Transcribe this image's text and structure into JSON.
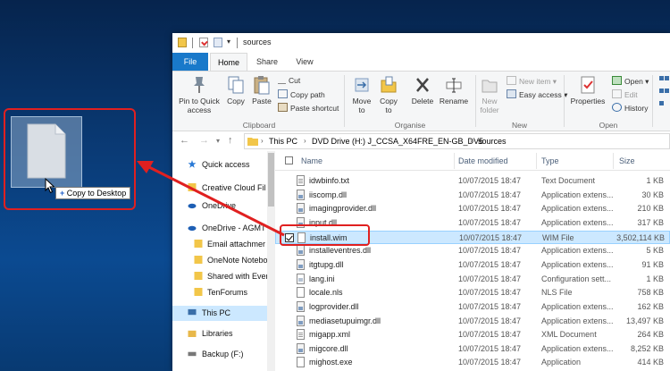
{
  "desktop": {
    "drag_tooltip_plus": "+",
    "drag_tooltip_text": "Copy to Desktop"
  },
  "window": {
    "title": "sources",
    "tabs": [
      "File",
      "Home",
      "Share",
      "View"
    ],
    "ribbon": {
      "clipboard": {
        "pin_label": "Pin to Quick access",
        "copy_label": "Copy",
        "paste_label": "Paste",
        "cut_label": "Cut",
        "copy_path_label": "Copy path",
        "paste_shortcut_label": "Paste shortcut",
        "group_label": "Clipboard"
      },
      "organise": {
        "move_to_label": "Move to",
        "copy_to_label": "Copy to",
        "delete_label": "Delete",
        "rename_label": "Rename",
        "group_label": "Organise"
      },
      "new": {
        "new_folder_label": "New folder",
        "new_item_label": "New item",
        "easy_access_label": "Easy access",
        "group_label": "New"
      },
      "open": {
        "properties_label": "Properties",
        "open_label": "Open",
        "edit_label": "Edit",
        "history_label": "History",
        "group_label": "Open"
      }
    },
    "address": {
      "crumbs": [
        "This PC",
        "DVD Drive (H:) J_CCSA_X64FRE_EN-GB_DV5",
        "sources"
      ]
    },
    "nav_items": [
      {
        "label": "Quick access",
        "icon": "star-icon"
      },
      {
        "label": "Creative Cloud Fil",
        "icon": "cloud-icon"
      },
      {
        "label": "OneDrive",
        "icon": "onedrive-icon"
      },
      {
        "label": "OneDrive - AGMT",
        "icon": "onedrive-icon"
      },
      {
        "label": "Email attachmer",
        "icon": "folder-icon"
      },
      {
        "label": "OneNote Notebo",
        "icon": "folder-icon"
      },
      {
        "label": "Shared with Ever",
        "icon": "folder-icon"
      },
      {
        "label": "TenForums",
        "icon": "folder-icon"
      },
      {
        "label": "This PC",
        "icon": "pc-icon"
      },
      {
        "label": "Libraries",
        "icon": "library-icon"
      },
      {
        "label": "Backup (F:)",
        "icon": "drive-icon"
      }
    ],
    "columns": {
      "name": "Name",
      "date": "Date modified",
      "type": "Type",
      "size": "Size"
    },
    "files": [
      {
        "name": "idwbinfo.txt",
        "date": "10/07/2015 18:47",
        "type": "Text Document",
        "size": "1 KB",
        "icon": "txt"
      },
      {
        "name": "iiscomp.dll",
        "date": "10/07/2015 18:47",
        "type": "Application extens...",
        "size": "30 KB",
        "icon": "dll"
      },
      {
        "name": "imagingprovider.dll",
        "date": "10/07/2015 18:47",
        "type": "Application extens...",
        "size": "210 KB",
        "icon": "dll"
      },
      {
        "name": "input.dll",
        "date": "10/07/2015 18:47",
        "type": "Application extens...",
        "size": "317 KB",
        "icon": "dll"
      },
      {
        "name": "install.wim",
        "date": "10/07/2015 18:47",
        "type": "WIM File",
        "size": "3,502,114 KB",
        "icon": "file"
      },
      {
        "name": "installeventres.dll",
        "date": "10/07/2015 18:47",
        "type": "Application extens...",
        "size": "5 KB",
        "icon": "dll"
      },
      {
        "name": "itgtupg.dll",
        "date": "10/07/2015 18:47",
        "type": "Application extens...",
        "size": "91 KB",
        "icon": "dll"
      },
      {
        "name": "lang.ini",
        "date": "10/07/2015 18:47",
        "type": "Configuration sett...",
        "size": "1 KB",
        "icon": "ini"
      },
      {
        "name": "locale.nls",
        "date": "10/07/2015 18:47",
        "type": "NLS File",
        "size": "758 KB",
        "icon": "file"
      },
      {
        "name": "logprovider.dll",
        "date": "10/07/2015 18:47",
        "type": "Application extens...",
        "size": "162 KB",
        "icon": "dll"
      },
      {
        "name": "mediasetupuimgr.dll",
        "date": "10/07/2015 18:47",
        "type": "Application extens...",
        "size": "13,497 KB",
        "icon": "dll"
      },
      {
        "name": "migapp.xml",
        "date": "10/07/2015 18:47",
        "type": "XML Document",
        "size": "264 KB",
        "icon": "txt"
      },
      {
        "name": "migcore.dll",
        "date": "10/07/2015 18:47",
        "type": "Application extens...",
        "size": "8,252 KB",
        "icon": "dll"
      },
      {
        "name": "mighost.exe",
        "date": "10/07/2015 18:47",
        "type": "Application",
        "size": "414 KB",
        "icon": "exe"
      }
    ],
    "selected_index": 4,
    "colors": {
      "accent": "#1979ca",
      "highlight": "#e02020",
      "selection": "#cce8ff"
    }
  }
}
